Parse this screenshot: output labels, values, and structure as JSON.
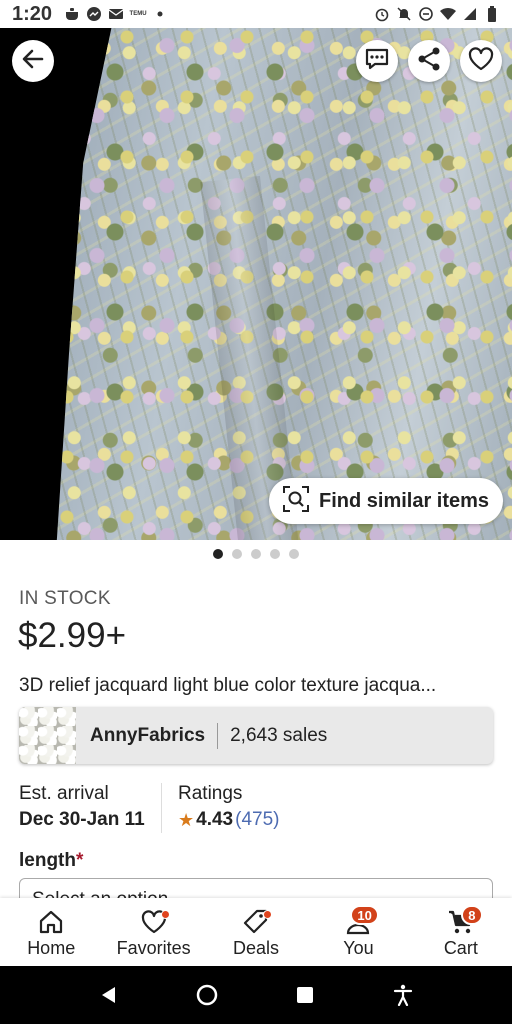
{
  "status_bar": {
    "time": "1:20",
    "temu_label": "TEMU"
  },
  "hero": {
    "find_similar_label": "Find similar items",
    "image_count": 5,
    "active_image_index": 0
  },
  "product": {
    "stock_status": "IN STOCK",
    "price": "$2.99+",
    "title": "3D relief jacquard light blue color texture jacqua..."
  },
  "shop": {
    "name": "AnnyFabrics",
    "sales": "2,643 sales"
  },
  "details": {
    "arrival_label": "Est. arrival",
    "arrival_value": "Dec 30-Jan 11",
    "ratings_label": "Ratings",
    "rating_value": "4.43",
    "rating_count": "(475)"
  },
  "options": {
    "length_label": "length",
    "required_marker": "*",
    "select_placeholder": "Select an option"
  },
  "bottom_nav": {
    "items": [
      {
        "label": "Home"
      },
      {
        "label": "Favorites"
      },
      {
        "label": "Deals"
      },
      {
        "label": "You",
        "badge": "10"
      },
      {
        "label": "Cart",
        "badge": "8"
      }
    ]
  },
  "colors": {
    "accent_orange": "#d2421a",
    "star": "#d97b1c",
    "link_blue": "#4d6bb1",
    "required_red": "#a61a2e"
  }
}
